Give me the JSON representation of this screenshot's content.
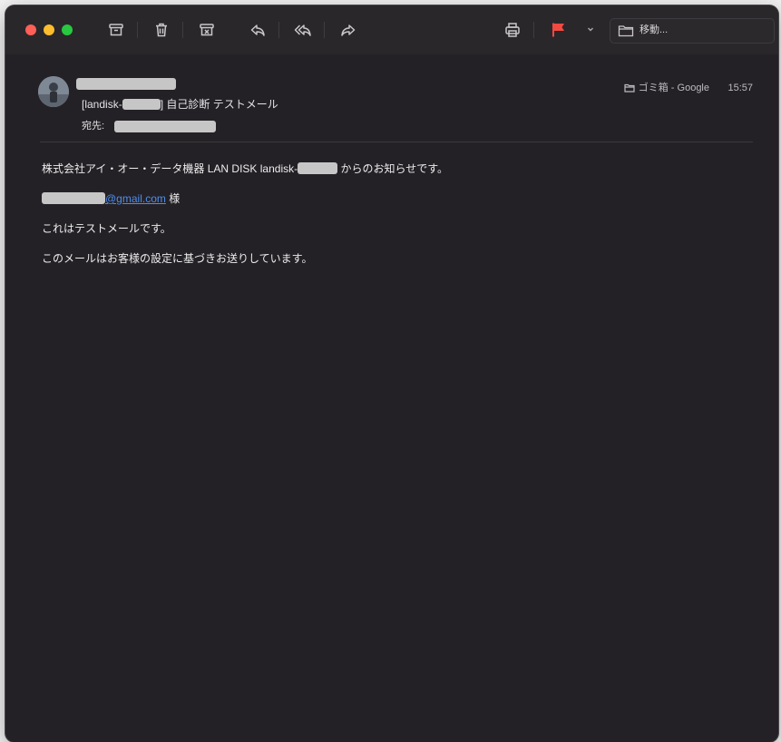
{
  "toolbar": {
    "move_label": "移動..."
  },
  "message": {
    "subject_prefix": "[landisk-",
    "subject_suffix": "] 自己診断 テストメール",
    "to_label": "宛先:",
    "mailbox": "ゴミ箱 - Google",
    "time": "15:57"
  },
  "body": {
    "line1_prefix": "株式会社アイ・オー・データ機器 LAN DISK landisk-",
    "line1_suffix": " からのお知らせです。",
    "email_domain": "@gmail.com",
    "honorific": " 様",
    "line3": "これはテストメールです。",
    "line4": "このメールはお客様の設定に基づきお送りしています。"
  },
  "colors": {
    "window_bg": "#242126",
    "flag": "#f24a40",
    "link": "#4d8eef"
  },
  "icons": [
    "archive-icon",
    "trash-icon",
    "junk-icon",
    "reply-icon",
    "reply-all-icon",
    "forward-icon",
    "print-icon",
    "flag-icon",
    "chevron-down-icon",
    "folder-icon"
  ]
}
